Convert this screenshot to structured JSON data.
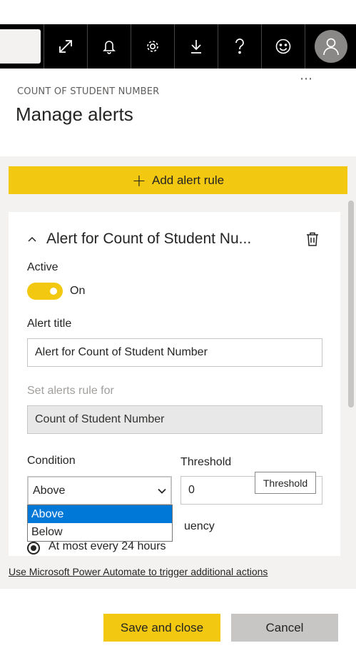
{
  "header": {
    "subtitle": "COUNT OF STUDENT NUMBER",
    "title": "Manage alerts",
    "more": "⋯",
    "icons": [
      "expand-icon",
      "bell-icon",
      "gear-icon",
      "download-icon",
      "help-icon",
      "smiley-icon",
      "avatar"
    ]
  },
  "add_rule": {
    "label": "Add alert rule",
    "plus": "+"
  },
  "alert": {
    "title": "Alert for Count of Student Nu...",
    "active_label": "Active",
    "toggle_state": "On",
    "alert_title_label": "Alert title",
    "alert_title_value": "Alert for Count of Student Number",
    "set_rule_label": "Set alerts rule for",
    "set_rule_value": "Count of Student Number",
    "condition_label": "Condition",
    "condition_value": "Above",
    "threshold_label": "Threshold",
    "threshold_value": "0",
    "threshold_tooltip": "Threshold",
    "frequency_label_partial": "uency",
    "frequency_option": "At most every 24 hours"
  },
  "dropdown": {
    "options": [
      "Above",
      "Below"
    ],
    "selected": "Above"
  },
  "footer": {
    "power_automate_link": "Use Microsoft Power Automate to trigger additional actions",
    "save_label": "Save and close",
    "cancel_label": "Cancel"
  },
  "colors": {
    "accent": "#f2c811",
    "topbar": "#000000",
    "panel": "#f3f2f1",
    "select_highlight": "#0078d7"
  }
}
